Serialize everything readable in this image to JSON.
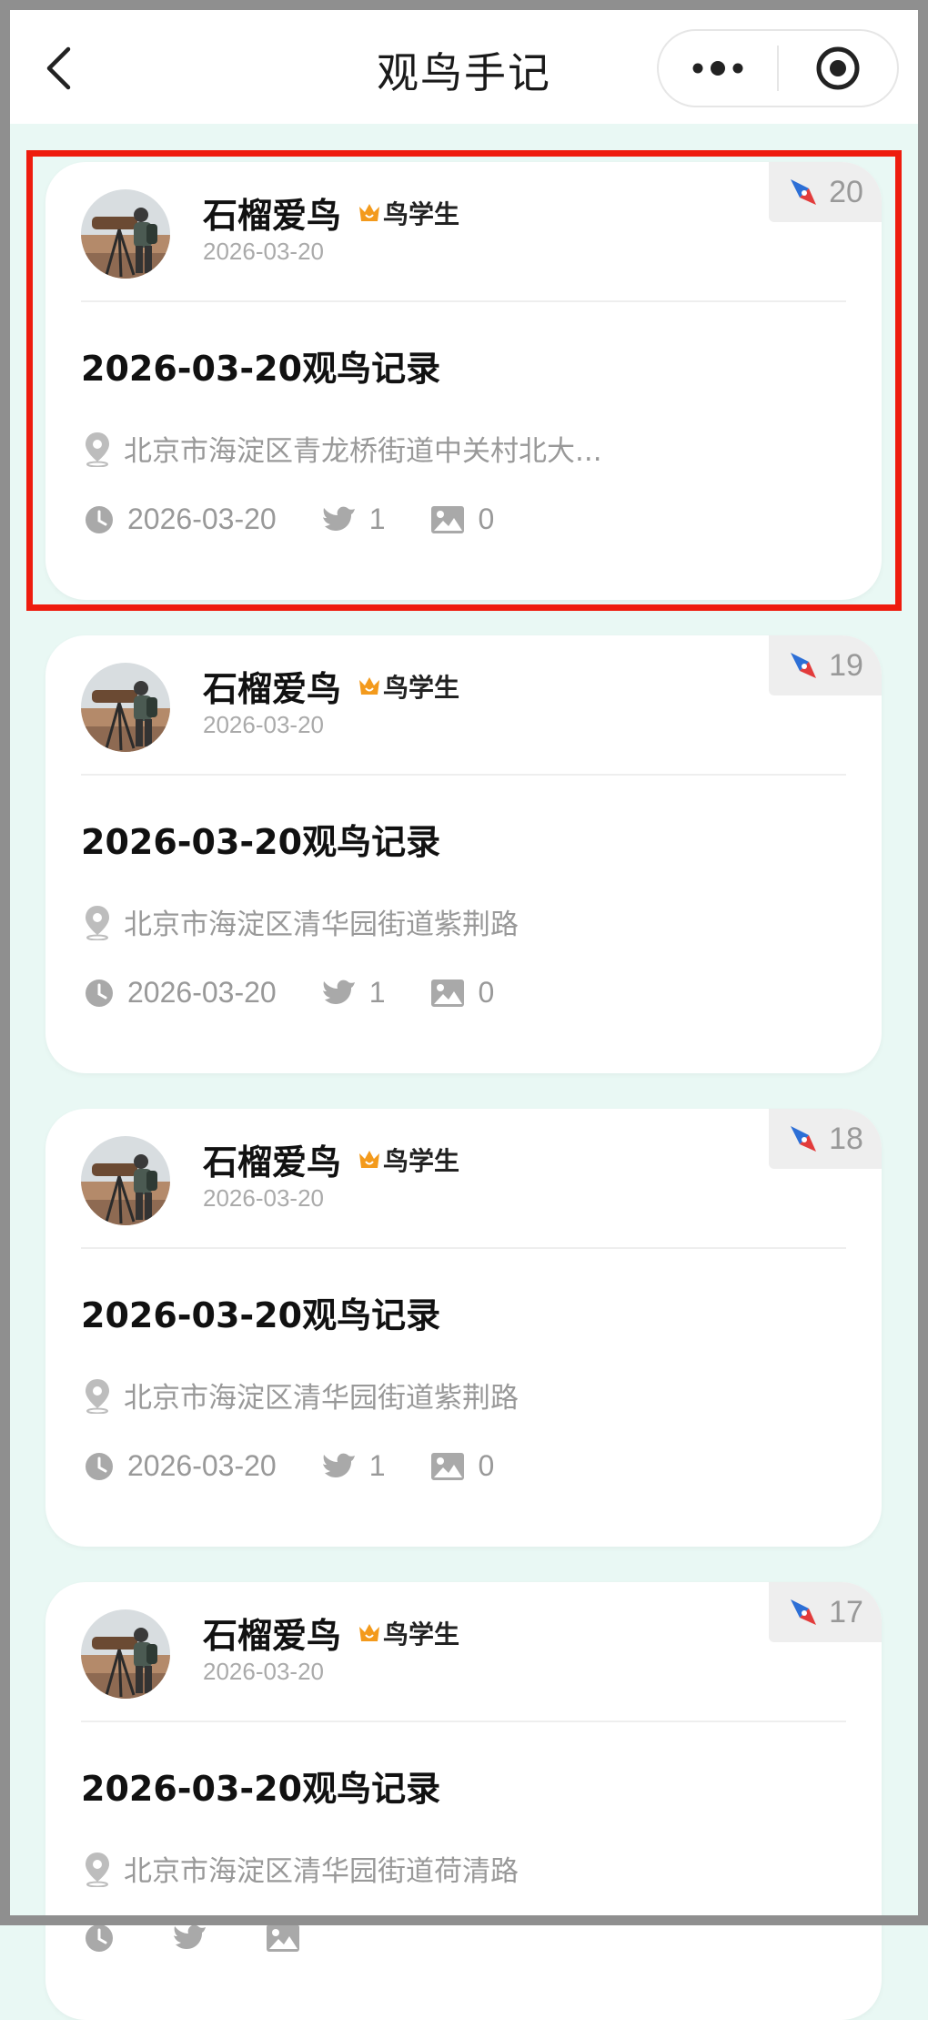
{
  "nav": {
    "title": "观鸟手记"
  },
  "cards": [
    {
      "id_badge": "20",
      "username": "石榴爱鸟",
      "level": "鸟学生",
      "user_date": "2026-03-20",
      "title": "2026-03-20观鸟记录",
      "location": "北京市海淀区青龙桥街道中关村北大...",
      "date": "2026-03-20",
      "bird_count": "1",
      "photo_count": "0"
    },
    {
      "id_badge": "19",
      "username": "石榴爱鸟",
      "level": "鸟学生",
      "user_date": "2026-03-20",
      "title": "2026-03-20观鸟记录",
      "location": "北京市海淀区清华园街道紫荆路",
      "date": "2026-03-20",
      "bird_count": "1",
      "photo_count": "0"
    },
    {
      "id_badge": "18",
      "username": "石榴爱鸟",
      "level": "鸟学生",
      "user_date": "2026-03-20",
      "title": "2026-03-20观鸟记录",
      "location": "北京市海淀区清华园街道紫荆路",
      "date": "2026-03-20",
      "bird_count": "1",
      "photo_count": "0"
    },
    {
      "id_badge": "17",
      "username": "石榴爱鸟",
      "level": "鸟学生",
      "user_date": "2026-03-20",
      "title": "2026-03-20观鸟记录",
      "location": "北京市海淀区清华园街道荷清路",
      "date": "",
      "bird_count": "",
      "photo_count": ""
    }
  ],
  "colors": {
    "background": "#e9f8f4",
    "highlight": "#ee1c0e",
    "badge_blue": "#2d6fd6",
    "badge_red": "#e23b3b",
    "level_orange": "#f39a1c"
  }
}
